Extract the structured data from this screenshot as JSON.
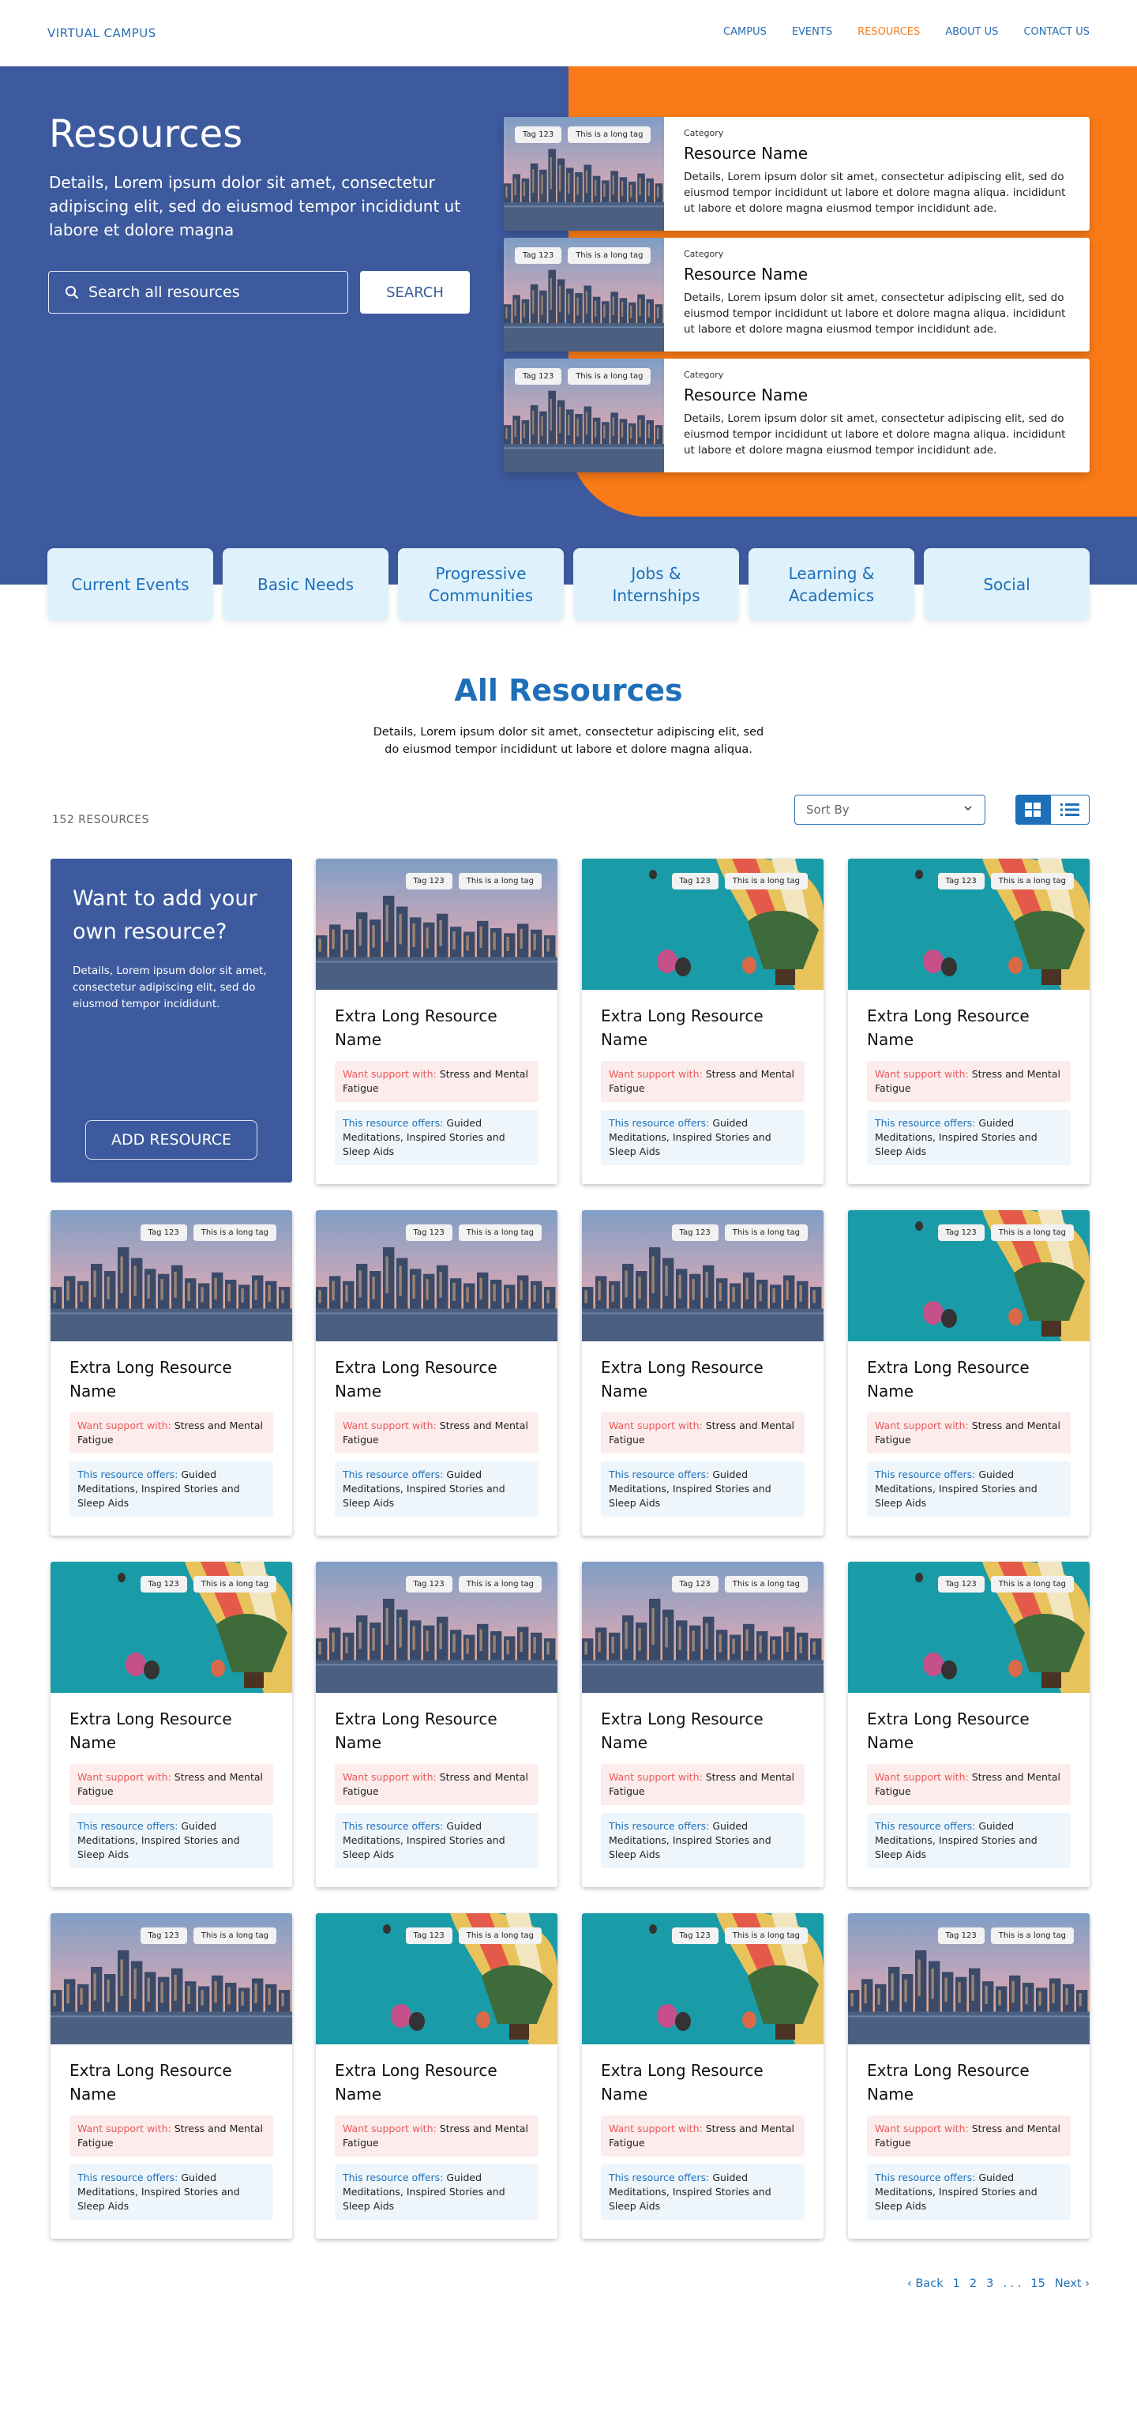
{
  "nav": {
    "brand": "VIRTUAL CAMPUS",
    "links": [
      "CAMPUS",
      "EVENTS",
      "RESOURCES",
      "ABOUT US",
      "CONTACT US"
    ]
  },
  "hero": {
    "title": "Resources",
    "description": "Details, Lorem ipsum dolor sit amet, consectetur adipiscing elit, sed do eiusmod tempor incididunt ut labore et dolore magna",
    "search_placeholder": "Search all resources",
    "search_button": "SEARCH",
    "featured": [
      {
        "tags": [
          "Tag 123",
          "This is a long tag"
        ],
        "category": "Category",
        "name": "Resource Name",
        "description": "Details, Lorem ipsum dolor sit amet, consectetur adipiscing elit, sed do eiusmod tempor incididunt ut labore et dolore magna aliqua. incididunt ut labore et dolore magna eiusmod tempor incididunt ade."
      },
      {
        "tags": [
          "Tag 123",
          "This is a long tag"
        ],
        "category": "Category",
        "name": "Resource Name",
        "description": "Details, Lorem ipsum dolor sit amet, consectetur adipiscing elit, sed do eiusmod tempor incididunt ut labore et dolore magna aliqua. incididunt ut labore et dolore magna eiusmod tempor incididunt ade."
      },
      {
        "tags": [
          "Tag 123",
          "This is a long tag"
        ],
        "category": "Category",
        "name": "Resource Name",
        "description": "Details, Lorem ipsum dolor sit amet, consectetur adipiscing elit, sed do eiusmod tempor incididunt ut labore et dolore magna aliqua. incididunt ut labore et dolore magna eiusmod tempor incididunt ade."
      }
    ]
  },
  "categories": [
    {
      "line1": "Current Events",
      "line2": ""
    },
    {
      "line1": "Basic Needs",
      "line2": ""
    },
    {
      "line1": "Progressive",
      "line2": "Communities"
    },
    {
      "line1": "Jobs &",
      "line2": "Internships"
    },
    {
      "line1": "Learning &",
      "line2": "Academics"
    },
    {
      "line1": "Social",
      "line2": ""
    }
  ],
  "all_resources": {
    "title": "All Resources",
    "description": "Details, Lorem ipsum dolor sit amet, consectetur adipiscing elit, sed do eiusmod tempor incididunt ut labore et dolore magna aliqua.",
    "count": "152 RESOURCES",
    "sort_placeholder": "Sort By"
  },
  "add_card": {
    "title": "Want to add your own resource?",
    "description": "Details, Lorem ipsum dolor sit amet, consectetur adipiscing elit, sed do eiusmod tempor incididunt.",
    "button": "ADD RESOURCE"
  },
  "card_template": {
    "tags": [
      "Tag 123",
      "This is a long tag"
    ],
    "name": "Extra Long Resource Name",
    "want_label": "Want support with:",
    "want_value": "Stress and Mental Fatigue",
    "offer_label": "This resource offers:",
    "offer_value": "Guided Meditations, Inspired Stories and Sleep Aids"
  },
  "cards": [
    {
      "image": "city"
    },
    {
      "image": "balloons"
    },
    {
      "image": "balloons"
    },
    {
      "image": "city"
    },
    {
      "image": "city"
    },
    {
      "image": "city"
    },
    {
      "image": "balloons"
    },
    {
      "image": "balloons"
    },
    {
      "image": "city"
    },
    {
      "image": "city"
    },
    {
      "image": "balloons"
    },
    {
      "image": "city"
    },
    {
      "image": "balloons"
    },
    {
      "image": "balloons"
    },
    {
      "image": "city"
    }
  ],
  "pagination": {
    "back": "‹ Back",
    "pages": [
      "1",
      "2",
      "3"
    ],
    "ellipsis": ". . .",
    "last": "15",
    "next": "Next ›"
  },
  "icons": {
    "search": "search-icon",
    "chevron": "chevron-down-icon",
    "grid": "grid-view-icon",
    "list": "list-view-icon"
  },
  "colors": {
    "primary_blue": "#3d5a9e",
    "accent_orange": "#f97a16",
    "link_blue": "#1e6fb8",
    "tile_bg": "#dff2fb"
  }
}
